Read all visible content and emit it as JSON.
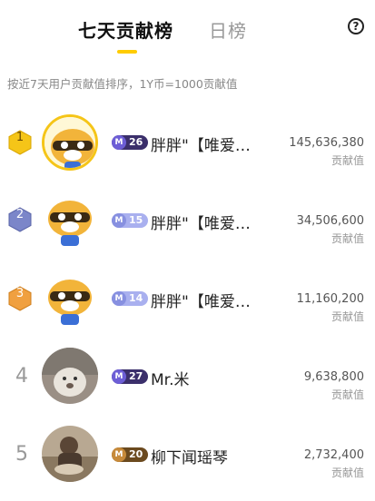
{
  "tabs": {
    "weekly": "七天贡献榜",
    "daily": "日榜"
  },
  "help_icon_glyph": "?",
  "description": "按近7天用户贡献值排序，1Y币=1000贡献值",
  "score_label": "贡献值",
  "rows": [
    {
      "rank": "1",
      "level": "26",
      "nickname": "胖胖\"【唯爱…",
      "score": "145,636,380",
      "badge_color": "#f5c518"
    },
    {
      "rank": "2",
      "level": "15",
      "nickname": "胖胖\"【唯爱…",
      "score": "34,506,600",
      "badge_color": "#7b86c9"
    },
    {
      "rank": "3",
      "level": "14",
      "nickname": "胖胖\"【唯爱…",
      "score": "11,160,200",
      "badge_color": "#f0a040"
    },
    {
      "rank": "4",
      "level": "27",
      "nickname": "Mr.米",
      "score": "9,638,800"
    },
    {
      "rank": "5",
      "level": "20",
      "nickname": "柳下闻瑶琴",
      "score": "2,732,400"
    }
  ],
  "colors": {
    "accent": "#ffcc00",
    "level_dark": "#3b2f6b",
    "level_light": "#a9b0ef",
    "level_gold": "#6b4a1f"
  }
}
